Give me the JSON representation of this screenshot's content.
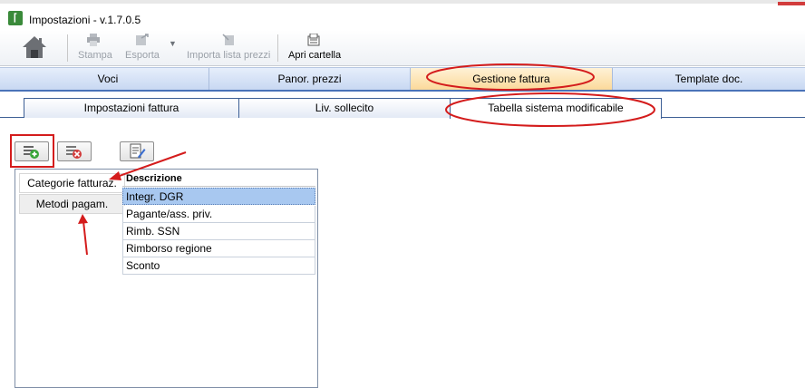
{
  "window": {
    "title": "Impostazioni  -  v.1.7.0.5"
  },
  "toolbar": {
    "print_label": "Stampa",
    "export_label": "Esporta",
    "import_price_list_label": "Importa lista prezzi",
    "open_folder_label": "Apri cartella"
  },
  "main_tabs": [
    {
      "label": "Voci"
    },
    {
      "label": "Panor. prezzi"
    },
    {
      "label": "Gestione fattura",
      "active": true
    },
    {
      "label": "Template doc."
    }
  ],
  "sub_tabs": [
    {
      "label": "Impostazioni fattura"
    },
    {
      "label": "Liv. sollecito"
    },
    {
      "label": "Tabella sistema modificabile",
      "active": true
    }
  ],
  "categories": [
    {
      "label": "Categorie fatturaz.",
      "selected": true
    },
    {
      "label": "Metodi pagam."
    }
  ],
  "table": {
    "header": "Descrizione",
    "rows": [
      "Integr. DGR",
      "Pagante/ass. priv.",
      "Rimb. SSN",
      "Rimborso regione",
      "Sconto"
    ],
    "selected_row": 0
  },
  "colors": {
    "active_tab": "#fbd99a",
    "selected_row": "#a8c8f0",
    "annotation_red": "#d41c1c"
  }
}
